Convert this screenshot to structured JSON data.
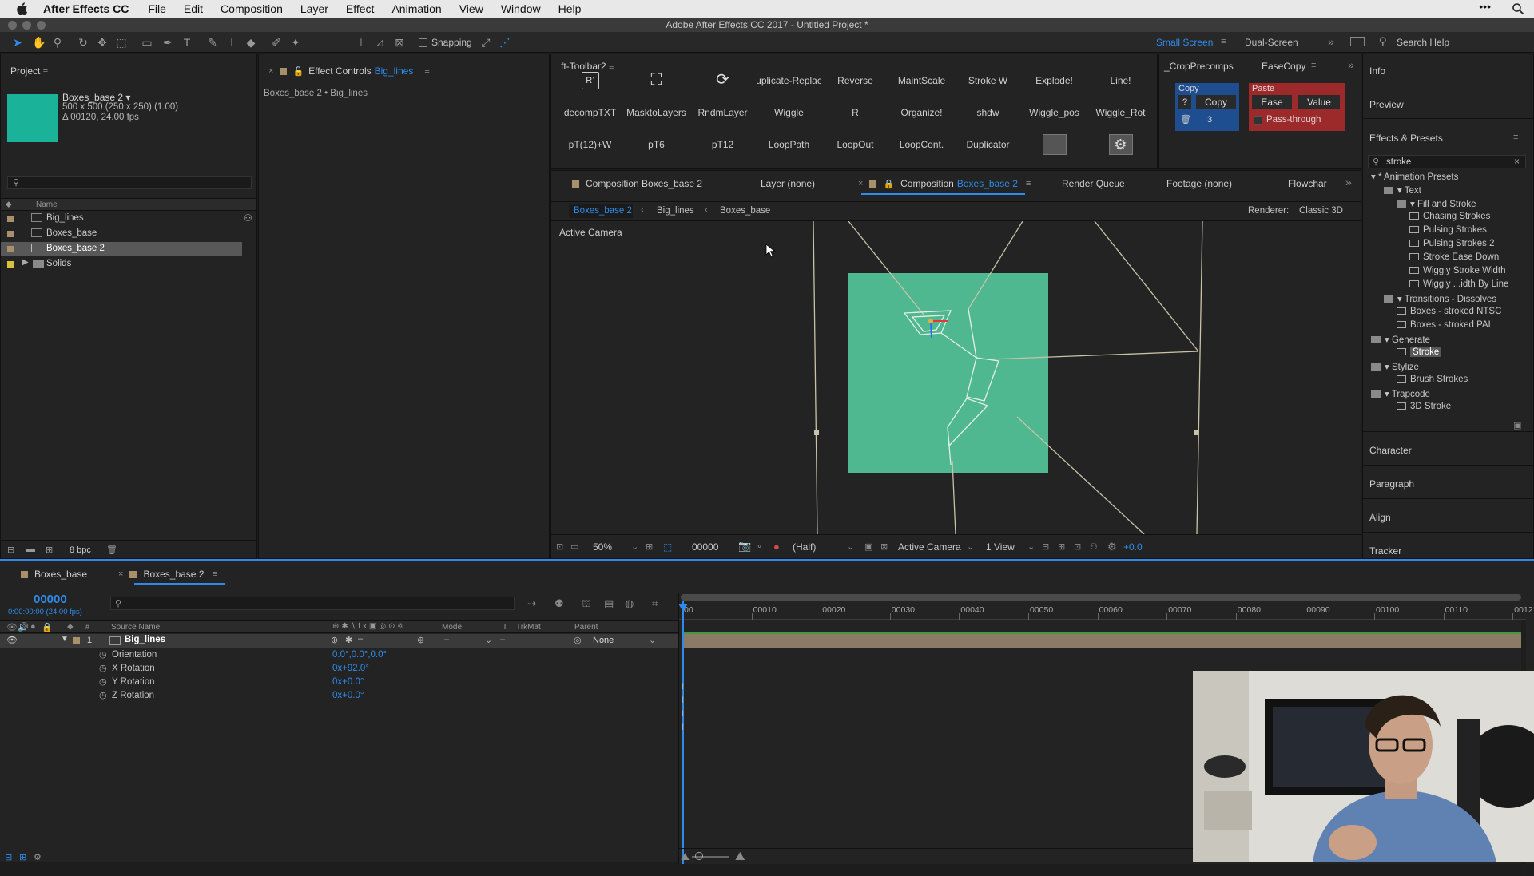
{
  "menubar": {
    "app": "After Effects CC",
    "items": [
      "File",
      "Edit",
      "Composition",
      "Layer",
      "Effect",
      "Animation",
      "View",
      "Window",
      "Help"
    ]
  },
  "window": {
    "title": "Adobe After Effects CC 2017 - Untitled Project *"
  },
  "toolbar": {
    "snapping": "Snapping",
    "workspaces": [
      "Small Screen",
      "Dual-Screen"
    ],
    "search_help": "Search Help"
  },
  "project": {
    "tab": "Project",
    "selected_name": "Boxes_base 2 ▾",
    "selected_info": [
      "500 x 500  (250 x 250) (1.00)",
      "Δ 00120, 24.00 fps"
    ],
    "search_placeholder": "",
    "col_name": "Name",
    "items": [
      "Big_lines",
      "Boxes_base",
      "Boxes_base 2",
      "Solids"
    ],
    "bpc": "8 bpc"
  },
  "effect_controls": {
    "tab": "Effect Controls",
    "layer": "Big_lines",
    "breadcrumb": "Boxes_base 2 • Big_lines"
  },
  "ft_toolbar": {
    "tab": "ft-Toolbar2",
    "row1": [
      "Rʼ",
      "",
      "",
      "uplicate-Replac",
      "Reverse",
      "MaintScale",
      "Stroke W",
      "Explode!",
      "Line!"
    ],
    "row2": [
      "decompTXT",
      "MasktoLayers",
      "RndmLayer",
      "Wiggle",
      "R",
      "Organize!",
      "shdw",
      "Wiggle_pos",
      "Wiggle_Rot"
    ],
    "row3": [
      "pT(12)+W",
      "pT6",
      "pT12",
      "LoopPath",
      "LoopOut",
      "LoopCont.",
      "Duplicator",
      "",
      ""
    ]
  },
  "crop_panel": {
    "tabs": [
      "_CropPrecomps",
      "EaseCopy"
    ],
    "copy_label": "Copy",
    "q": "?",
    "copy_btn": "Copy",
    "count": "3",
    "paste_label": "Paste",
    "ease": "Ease",
    "value": "Value",
    "pass": "Pass-through"
  },
  "viewer": {
    "tabs": [
      "Composition Boxes_base 2",
      "Layer (none)",
      "Composition",
      "Render Queue",
      "Footage (none)",
      "Flowchar"
    ],
    "active_comp": "Boxes_base 2",
    "breadcrumbs": [
      "Boxes_base 2",
      "Big_lines",
      "Boxes_base"
    ],
    "renderer_label": "Renderer:",
    "renderer": "Classic 3D",
    "camera_label": "Active Camera",
    "bottom": {
      "zoom": "50%",
      "time": "00000",
      "res": "(Half)",
      "camera": "Active Camera",
      "views": "1 View",
      "exposure": "+0.0"
    }
  },
  "right_panels": {
    "info": "Info",
    "preview": "Preview",
    "effects": "Effects & Presets",
    "search": "stroke",
    "tree": [
      {
        "d": 0,
        "t": "▾ * Animation Presets"
      },
      {
        "d": 1,
        "t": "▾ Text"
      },
      {
        "d": 2,
        "t": "▾ Fill and Stroke"
      },
      {
        "d": 3,
        "t": "Chasing Strokes"
      },
      {
        "d": 3,
        "t": "Pulsing Strokes"
      },
      {
        "d": 3,
        "t": "Pulsing Strokes 2"
      },
      {
        "d": 3,
        "t": "Stroke Ease Down"
      },
      {
        "d": 3,
        "t": "Wiggly Stroke Width"
      },
      {
        "d": 3,
        "t": "Wiggly ...idth By Line"
      },
      {
        "d": 1,
        "t": "▾ Transitions - Dissolves"
      },
      {
        "d": 2,
        "t": "Boxes - stroked NTSC"
      },
      {
        "d": 2,
        "t": "Boxes - stroked PAL"
      },
      {
        "d": 0,
        "t": "▾ Generate"
      },
      {
        "d": 2,
        "t": "Stroke"
      },
      {
        "d": 0,
        "t": "▾ Stylize"
      },
      {
        "d": 2,
        "t": "Brush Strokes"
      },
      {
        "d": 0,
        "t": "▾ Trapcode"
      },
      {
        "d": 2,
        "t": "3D Stroke"
      }
    ],
    "character": "Character",
    "paragraph": "Paragraph",
    "align": "Align",
    "tracker": "Tracker"
  },
  "timeline": {
    "tabs": [
      "Boxes_base",
      "Boxes_base 2"
    ],
    "time": "00000",
    "time_sub": "0:00:00:00 (24.00 fps)",
    "cols": {
      "source": "Source Name",
      "mode": "Mode",
      "t": "T",
      "trkmat": "TrkMat",
      "parent": "Parent"
    },
    "layer": {
      "num": "1",
      "name": "Big_lines",
      "parent": "None",
      "mode": "–"
    },
    "props": [
      {
        "n": "Orientation",
        "v": "0.0°,0.0°,0.0°"
      },
      {
        "n": "X Rotation",
        "v": "0x+92.0°"
      },
      {
        "n": "Y Rotation",
        "v": "0x+0.0°"
      },
      {
        "n": "Z Rotation",
        "v": "0x+0.0°"
      }
    ],
    "ruler": [
      "00",
      "00010",
      "00020",
      "00030",
      "00040",
      "00050",
      "00060",
      "00070",
      "00080",
      "00090",
      "00100",
      "00110",
      "0012"
    ]
  },
  "colors": {
    "accent": "#2d8ceb",
    "teal": "#1ab39a",
    "comp": "#4fb891"
  }
}
